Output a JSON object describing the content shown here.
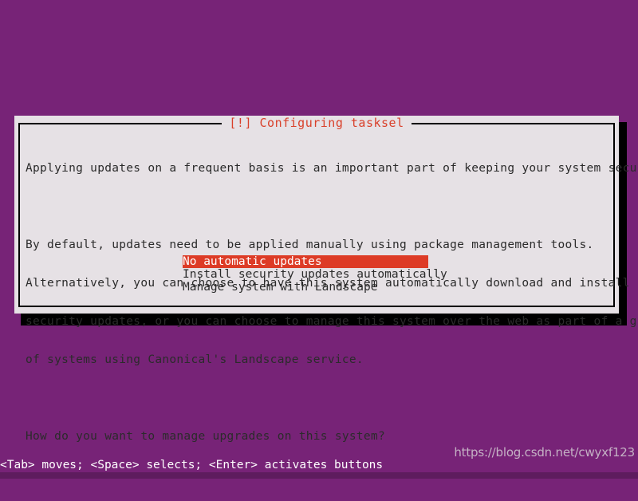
{
  "screen": {
    "background_color": "#772377",
    "terminal_text_color": "#ffffff"
  },
  "dialog": {
    "title": "[!] Configuring tasksel",
    "title_color": "#d9402a",
    "background_color": "#e6e1e5",
    "border_color": "#000000",
    "paragraphs": [
      "Applying updates on a frequent basis is an important part of keeping your system secure.",
      "By default, updates need to be applied manually using package management tools.\nAlternatively, you can choose to have this system automatically download and install\nsecurity updates, or you can choose to manage this system over the web as part of a group\nof systems using Canonical's Landscape service.",
      "How do you want to manage upgrades on this system?"
    ],
    "paragraph_1": "Applying updates on a frequent basis is an important part of keeping your system secure.",
    "paragraph_2_line_1": "By default, updates need to be applied manually using package management tools.",
    "paragraph_2_line_2": "Alternatively, you can choose to have this system automatically download and install",
    "paragraph_2_line_3": "security updates, or you can choose to manage this system over the web as part of a group",
    "paragraph_2_line_4": "of systems using Canonical's Landscape service.",
    "question": "How do you want to manage upgrades on this system?",
    "choices": [
      {
        "label": "No automatic updates",
        "selected": true
      },
      {
        "label": "Install security updates automatically",
        "selected": false
      },
      {
        "label": "Manage system with Landscape",
        "selected": false
      }
    ],
    "selected_index": 0,
    "selection_highlight_color": "#dd3b26",
    "selection_text_color": "#ffffff"
  },
  "statusbar": {
    "hint": "<Tab> moves; <Space> selects; <Enter> activates buttons"
  },
  "watermark": {
    "text": "https://blog.csdn.net/cwyxf123"
  }
}
